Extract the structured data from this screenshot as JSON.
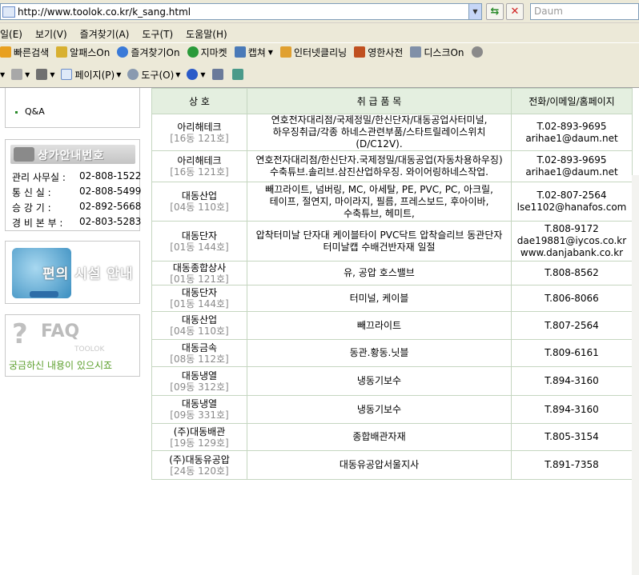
{
  "browser": {
    "url": "http://www.toolok.co.kr/k_sang.html",
    "search_placeholder": "Daum",
    "menu": [
      "일(E)",
      "보기(V)",
      "즐겨찾기(A)",
      "도구(T)",
      "도움말(H)"
    ],
    "links": [
      "빠른검색",
      "알패스On",
      "즐겨찾기On",
      "지마켓",
      "캡쳐",
      "인터넷클리닝",
      "영한사전",
      "디스크On"
    ],
    "commands": [
      "페이지(P)",
      "도구(O)"
    ]
  },
  "sidebar": {
    "qa": "Q&A",
    "info_title": "상가안내번호",
    "info_rows": [
      {
        "label": "관리 사무실 :",
        "value": "02-808-1522"
      },
      {
        "label": "통  신  실 :",
        "value": "02-808-5499"
      },
      {
        "label": "승  강  기 :",
        "value": "02-892-5668"
      },
      {
        "label": "경 비 본 부 :",
        "value": "02-803-5283"
      }
    ],
    "convenience": "편의 시설 안내",
    "faq": "FAQ",
    "faq_brand": "TOOLOK",
    "faq_text": "궁금하신 내용이 있으시죠"
  },
  "table": {
    "headers": [
      "상 호",
      "취 급 품 목",
      "전화/이메일/홈페이지"
    ],
    "rows": [
      {
        "name": "아리해테크",
        "room": "[16동 121호]",
        "items": "연호전자대리점/국제정밀/한신단자/대동공업사터미널, 하우징취급/각종 하네스관련부품/스타트릴레이스위치(D/C12V).",
        "contact": [
          "T.02-893-9695",
          "arihae1@daum.net"
        ]
      },
      {
        "name": "아리해테크",
        "room": "[16동 121호]",
        "items": "연호전자대리점/한신단자.국제정밀/대동공업(자동차용하우징)수축튜브.솔리브.삼진산업하우징. 와이어링하네스작업.",
        "contact": [
          "T.02-893-9695",
          "arihae1@daum.net"
        ]
      },
      {
        "name": "대동산업",
        "room": "[04동 110호]",
        "items": "빼끄라이트, 넘버링, MC, 아세탈, PE, PVC, PC, 아크릴, 테이프, 절연지, 마이라지, 필름, 프레스보드, 후아이바, 수축튜브, 헤미트,",
        "contact": [
          "T.02-807-2564",
          "lse1102@hanafos.com"
        ]
      },
      {
        "name": "대동단자",
        "room": "[01동 144호]",
        "items": "압착터미날 단자대 케이블타이 PVC닥트 압착슬리브 동관단자 터미날캡 수배건반자재 일절",
        "contact": [
          "T.808-9172",
          "dae19881@iycos.co.kr",
          "www.danjabank.co.kr"
        ]
      },
      {
        "name": "대동종합상사",
        "room": "[01동 121호]",
        "items": "유, 공압 호스밸브",
        "contact": [
          "T.808-8562"
        ]
      },
      {
        "name": "대동단자",
        "room": "[01동 144호]",
        "items": "터미널, 케이블",
        "contact": [
          "T.806-8066"
        ]
      },
      {
        "name": "대동산업",
        "room": "[04동 110호]",
        "items": "빼끄라이트",
        "contact": [
          "T.807-2564"
        ]
      },
      {
        "name": "대동금속",
        "room": "[08동 112호]",
        "items": "동관.황동.닛블",
        "contact": [
          "T.809-6161"
        ]
      },
      {
        "name": "대동냉열",
        "room": "[09동 312호]",
        "items": "냉동기보수",
        "contact": [
          "T.894-3160"
        ]
      },
      {
        "name": "대동냉열",
        "room": "[09동 331호]",
        "items": "냉동기보수",
        "contact": [
          "T.894-3160"
        ]
      },
      {
        "name": "(주)대동배관",
        "room": "[19동 129호]",
        "items": "종합배관자재",
        "contact": [
          "T.805-3154"
        ]
      },
      {
        "name": "(주)대동유공압",
        "room": "[24동 120호]",
        "items": "대동유공압서울지사",
        "contact": [
          "T.891-7358"
        ]
      }
    ]
  }
}
